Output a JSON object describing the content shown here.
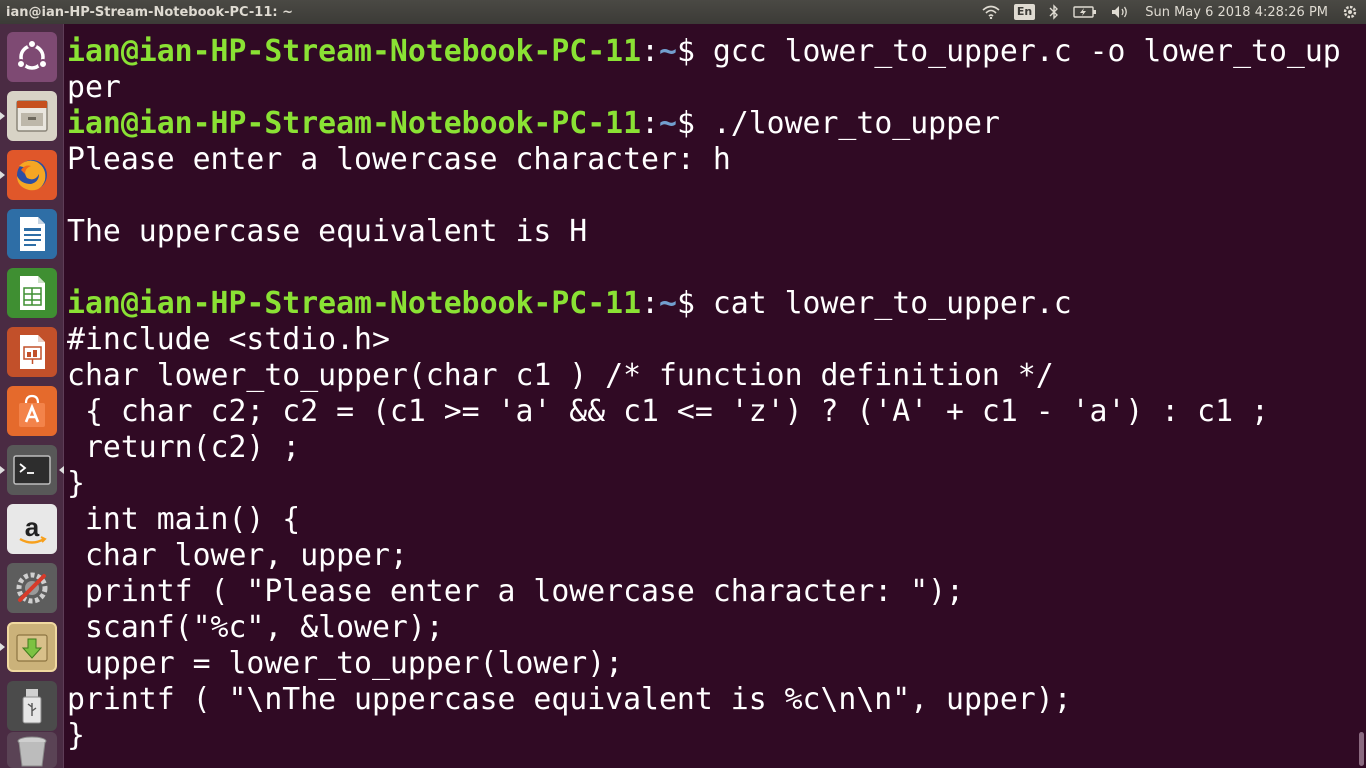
{
  "topbar": {
    "window_title": "ian@ian-HP-Stream-Notebook-PC-11: ~",
    "keyboard_layout": "En",
    "clock": "Sun May  6 2018  4:28:26 PM",
    "icons": [
      "wifi-icon",
      "bluetooth-icon",
      "battery-icon",
      "volume-icon",
      "power-gear-icon"
    ]
  },
  "launcher": {
    "items": [
      {
        "name": "ubuntu-dash",
        "icon": "ubuntu-logo-icon"
      },
      {
        "name": "files",
        "icon": "file-cabinet-icon"
      },
      {
        "name": "firefox",
        "icon": "firefox-icon"
      },
      {
        "name": "libreoffice-writer",
        "icon": "writer-document-icon"
      },
      {
        "name": "libreoffice-calc",
        "icon": "calc-spreadsheet-icon"
      },
      {
        "name": "libreoffice-impress",
        "icon": "impress-presentation-icon"
      },
      {
        "name": "ubuntu-software",
        "icon": "software-bag-icon"
      },
      {
        "name": "terminal",
        "icon": "terminal-icon"
      },
      {
        "name": "amazon",
        "icon": "amazon-icon"
      },
      {
        "name": "system-settings",
        "icon": "settings-wrench-icon"
      },
      {
        "name": "archive-manager",
        "icon": "download-box-icon"
      },
      {
        "name": "usb-drive",
        "icon": "usb-drive-icon"
      },
      {
        "name": "trash",
        "icon": "trash-icon"
      }
    ]
  },
  "terminal": {
    "prompt_user": "ian@ian-HP-Stream-Notebook-PC-11",
    "prompt_sep": ":",
    "prompt_path": "~",
    "prompt_symbol": "$",
    "cmd1a": " gcc lower_to_upper.c -o lower_to_up",
    "cmd1b": "per",
    "cmd2": " ./lower_to_upper",
    "out1": "Please enter a lowercase character: h",
    "out2": "",
    "out3": "The uppercase equivalent is H",
    "out4": "",
    "cmd3": " cat lower_to_upper.c",
    "code": [
      "#include <stdio.h>",
      "char lower_to_upper(char c1 ) /* function definition */",
      " { char c2; c2 = (c1 >= 'a' && c1 <= 'z') ? ('A' + c1 - 'a') : c1 ;",
      " return(c2) ;",
      "}",
      " int main() {",
      " char lower, upper;",
      " printf ( \"Please enter a lowercase character: \");",
      " scanf(\"%c\", &lower);",
      " upper = lower_to_upper(lower);",
      "printf ( \"\\nThe uppercase equivalent is %c\\n\\n\", upper);",
      "}"
    ]
  }
}
